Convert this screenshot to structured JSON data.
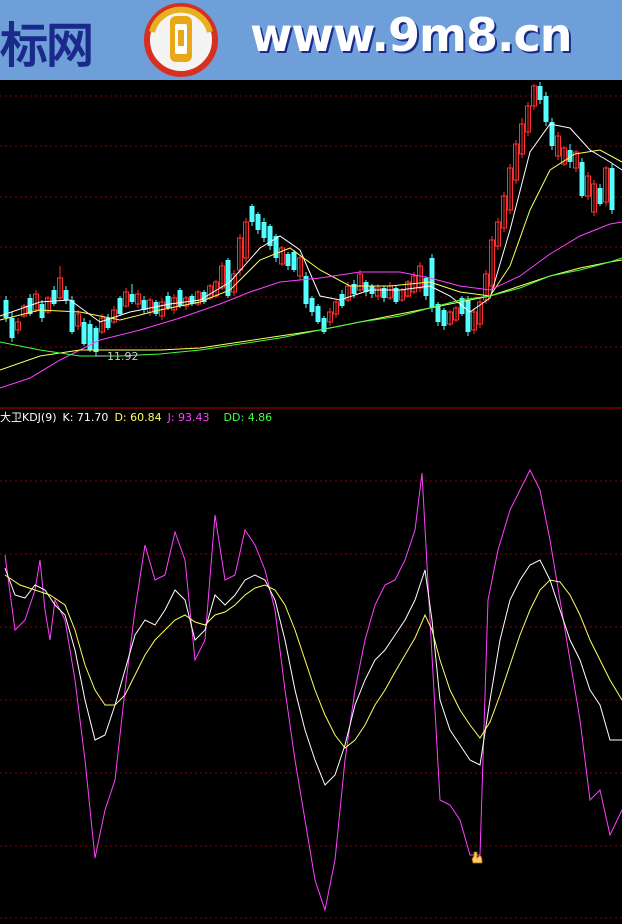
{
  "banner": {
    "left_text": "标网",
    "url_text": "www.9m8.cn"
  },
  "main_chart": {
    "low_marker_label": "11.92"
  },
  "kdj": {
    "title": "大卫KDJ(9)",
    "k_label": "K: 71.70",
    "d_label": "D: 60.84",
    "j_label": "J: 93.43",
    "dd_label": "DD: 4.86"
  },
  "colors": {
    "up": "#ff3030",
    "down": "#54ffff",
    "grid": "#8b0000",
    "k_line": "#ffffff",
    "d_line": "#ffff60",
    "j_line": "#ff40ff",
    "dd_text": "#40ff40",
    "ma_white": "#ffffff",
    "ma_yellow": "#ffff60",
    "ma_magenta": "#ff40ff",
    "ma_green": "#40ff40"
  }
}
